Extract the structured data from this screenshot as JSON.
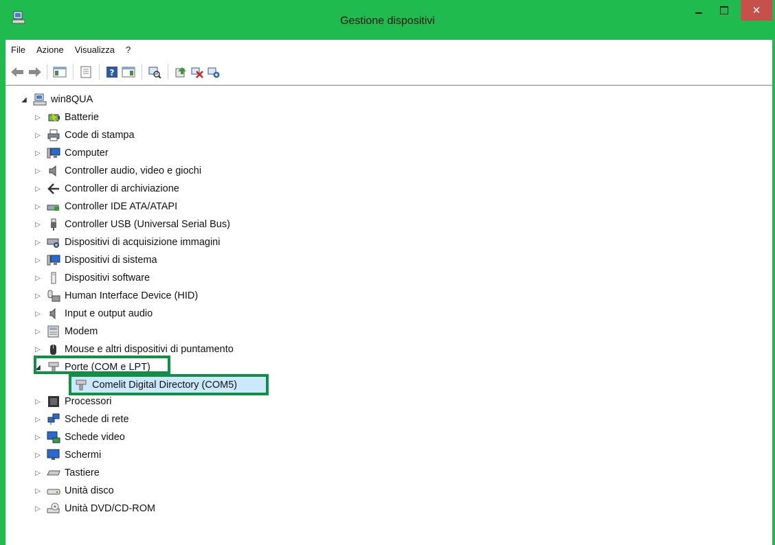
{
  "window": {
    "title": "Gestione dispositivi",
    "close_glyph": "✕",
    "accent": "#1fbb4f",
    "highlight": "#119045"
  },
  "menu": [
    "File",
    "Azione",
    "Visualizza",
    "?"
  ],
  "toolbar": {
    "icons": [
      "back-arrow-icon",
      "forward-arrow-icon",
      "console-tree-icon",
      "properties-icon",
      "help-icon",
      "action-pane-icon",
      "scan-hardware-icon",
      "update-driver-icon",
      "uninstall-device-icon",
      "enable-device-icon"
    ]
  },
  "tree": {
    "root": "win8QUA",
    "categories": [
      {
        "label": "Batterie",
        "icon": "battery-icon"
      },
      {
        "label": "Code di stampa",
        "icon": "printer-icon"
      },
      {
        "label": "Computer",
        "icon": "computer-icon"
      },
      {
        "label": "Controller audio, video e giochi",
        "icon": "speaker-icon"
      },
      {
        "label": "Controller di archiviazione",
        "icon": "storage-controller-icon"
      },
      {
        "label": "Controller IDE ATA/ATAPI",
        "icon": "ide-controller-icon"
      },
      {
        "label": "Controller USB (Universal Serial Bus)",
        "icon": "usb-icon"
      },
      {
        "label": "Dispositivi di acquisizione immagini",
        "icon": "scanner-icon"
      },
      {
        "label": "Dispositivi di sistema",
        "icon": "system-device-icon"
      },
      {
        "label": "Dispositivi software",
        "icon": "software-device-icon"
      },
      {
        "label": "Human Interface Device (HID)",
        "icon": "hid-icon"
      },
      {
        "label": "Input e output audio",
        "icon": "audio-io-icon"
      },
      {
        "label": "Modem",
        "icon": "modem-icon"
      },
      {
        "label": "Mouse e altri dispositivi di puntamento",
        "icon": "mouse-icon"
      },
      {
        "label": "Porte (COM e LPT)",
        "icon": "port-icon",
        "expanded": true
      },
      {
        "label": "Processori",
        "icon": "processor-icon"
      },
      {
        "label": "Schede di rete",
        "icon": "network-icon"
      },
      {
        "label": "Schede video",
        "icon": "display-adapter-icon"
      },
      {
        "label": "Schermi",
        "icon": "monitor-icon"
      },
      {
        "label": "Tastiere",
        "icon": "keyboard-icon"
      },
      {
        "label": "Unità disco",
        "icon": "disk-drive-icon"
      },
      {
        "label": "Unità DVD/CD-ROM",
        "icon": "dvd-drive-icon"
      }
    ],
    "port_child": {
      "label": "Comelit Digital Directory (COM5)",
      "icon": "port-icon"
    },
    "expanded_arrow": "◢",
    "collapsed_arrow": "▷"
  }
}
